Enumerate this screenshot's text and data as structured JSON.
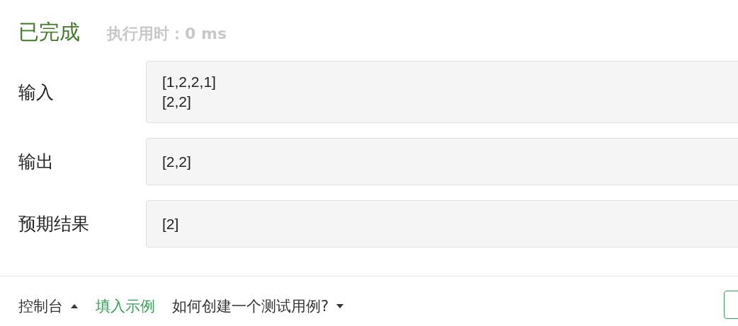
{
  "status": {
    "title": "已完成",
    "runtime": "执行用时：0 ms"
  },
  "rows": [
    {
      "label": "输入",
      "lines": [
        "[1,2,2,1]",
        "[2,2]"
      ]
    },
    {
      "label": "输出",
      "lines": [
        "[2,2]"
      ]
    },
    {
      "label": "预期结果",
      "lines": [
        "[2]"
      ]
    }
  ],
  "footer": {
    "console": "控制台",
    "fill_example": "填入示例",
    "help": "如何创建一个测试用例?"
  }
}
